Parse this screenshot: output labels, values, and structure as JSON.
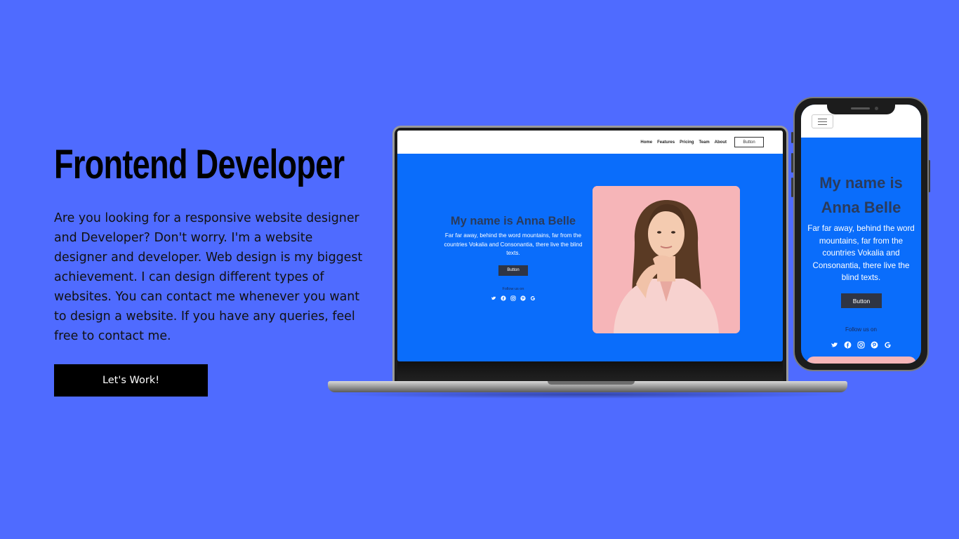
{
  "hero": {
    "title": "Frontend Developer",
    "description": "Are you looking for a responsive website designer and Developer? Don't worry. I'm a website designer and developer. Web design is my biggest achievement. I can design different types of websites. You can contact me whenever you want to design a website. If you have any queries, feel free to contact me.",
    "cta_label": "Let's Work!"
  },
  "laptop_site": {
    "nav": [
      "Home",
      "Features",
      "Pricing",
      "Team",
      "About"
    ],
    "nav_button": "Button",
    "title": "My name is Anna Belle",
    "description": "Far far away, behind the word mountains, far from the countries Vokalia and Consonantia, there live the blind texts.",
    "button": "Button",
    "follow": "Follow us on",
    "socials": [
      "twitter-icon",
      "facebook-icon",
      "instagram-icon",
      "pinterest-icon",
      "google-icon"
    ]
  },
  "phone_site": {
    "title": "My name is Anna Belle",
    "description": "Far far away, behind the word mountains, far from the countries Vokalia and Consonantia, there live the blind texts.",
    "button": "Button",
    "follow": "Follow us on"
  },
  "colors": {
    "page_background": "#4f6bff",
    "site_primary": "#0a6dfb",
    "site_title": "#2a3b5c",
    "photo_background": "#f6b5b8",
    "button_dark": "#2f3544"
  }
}
